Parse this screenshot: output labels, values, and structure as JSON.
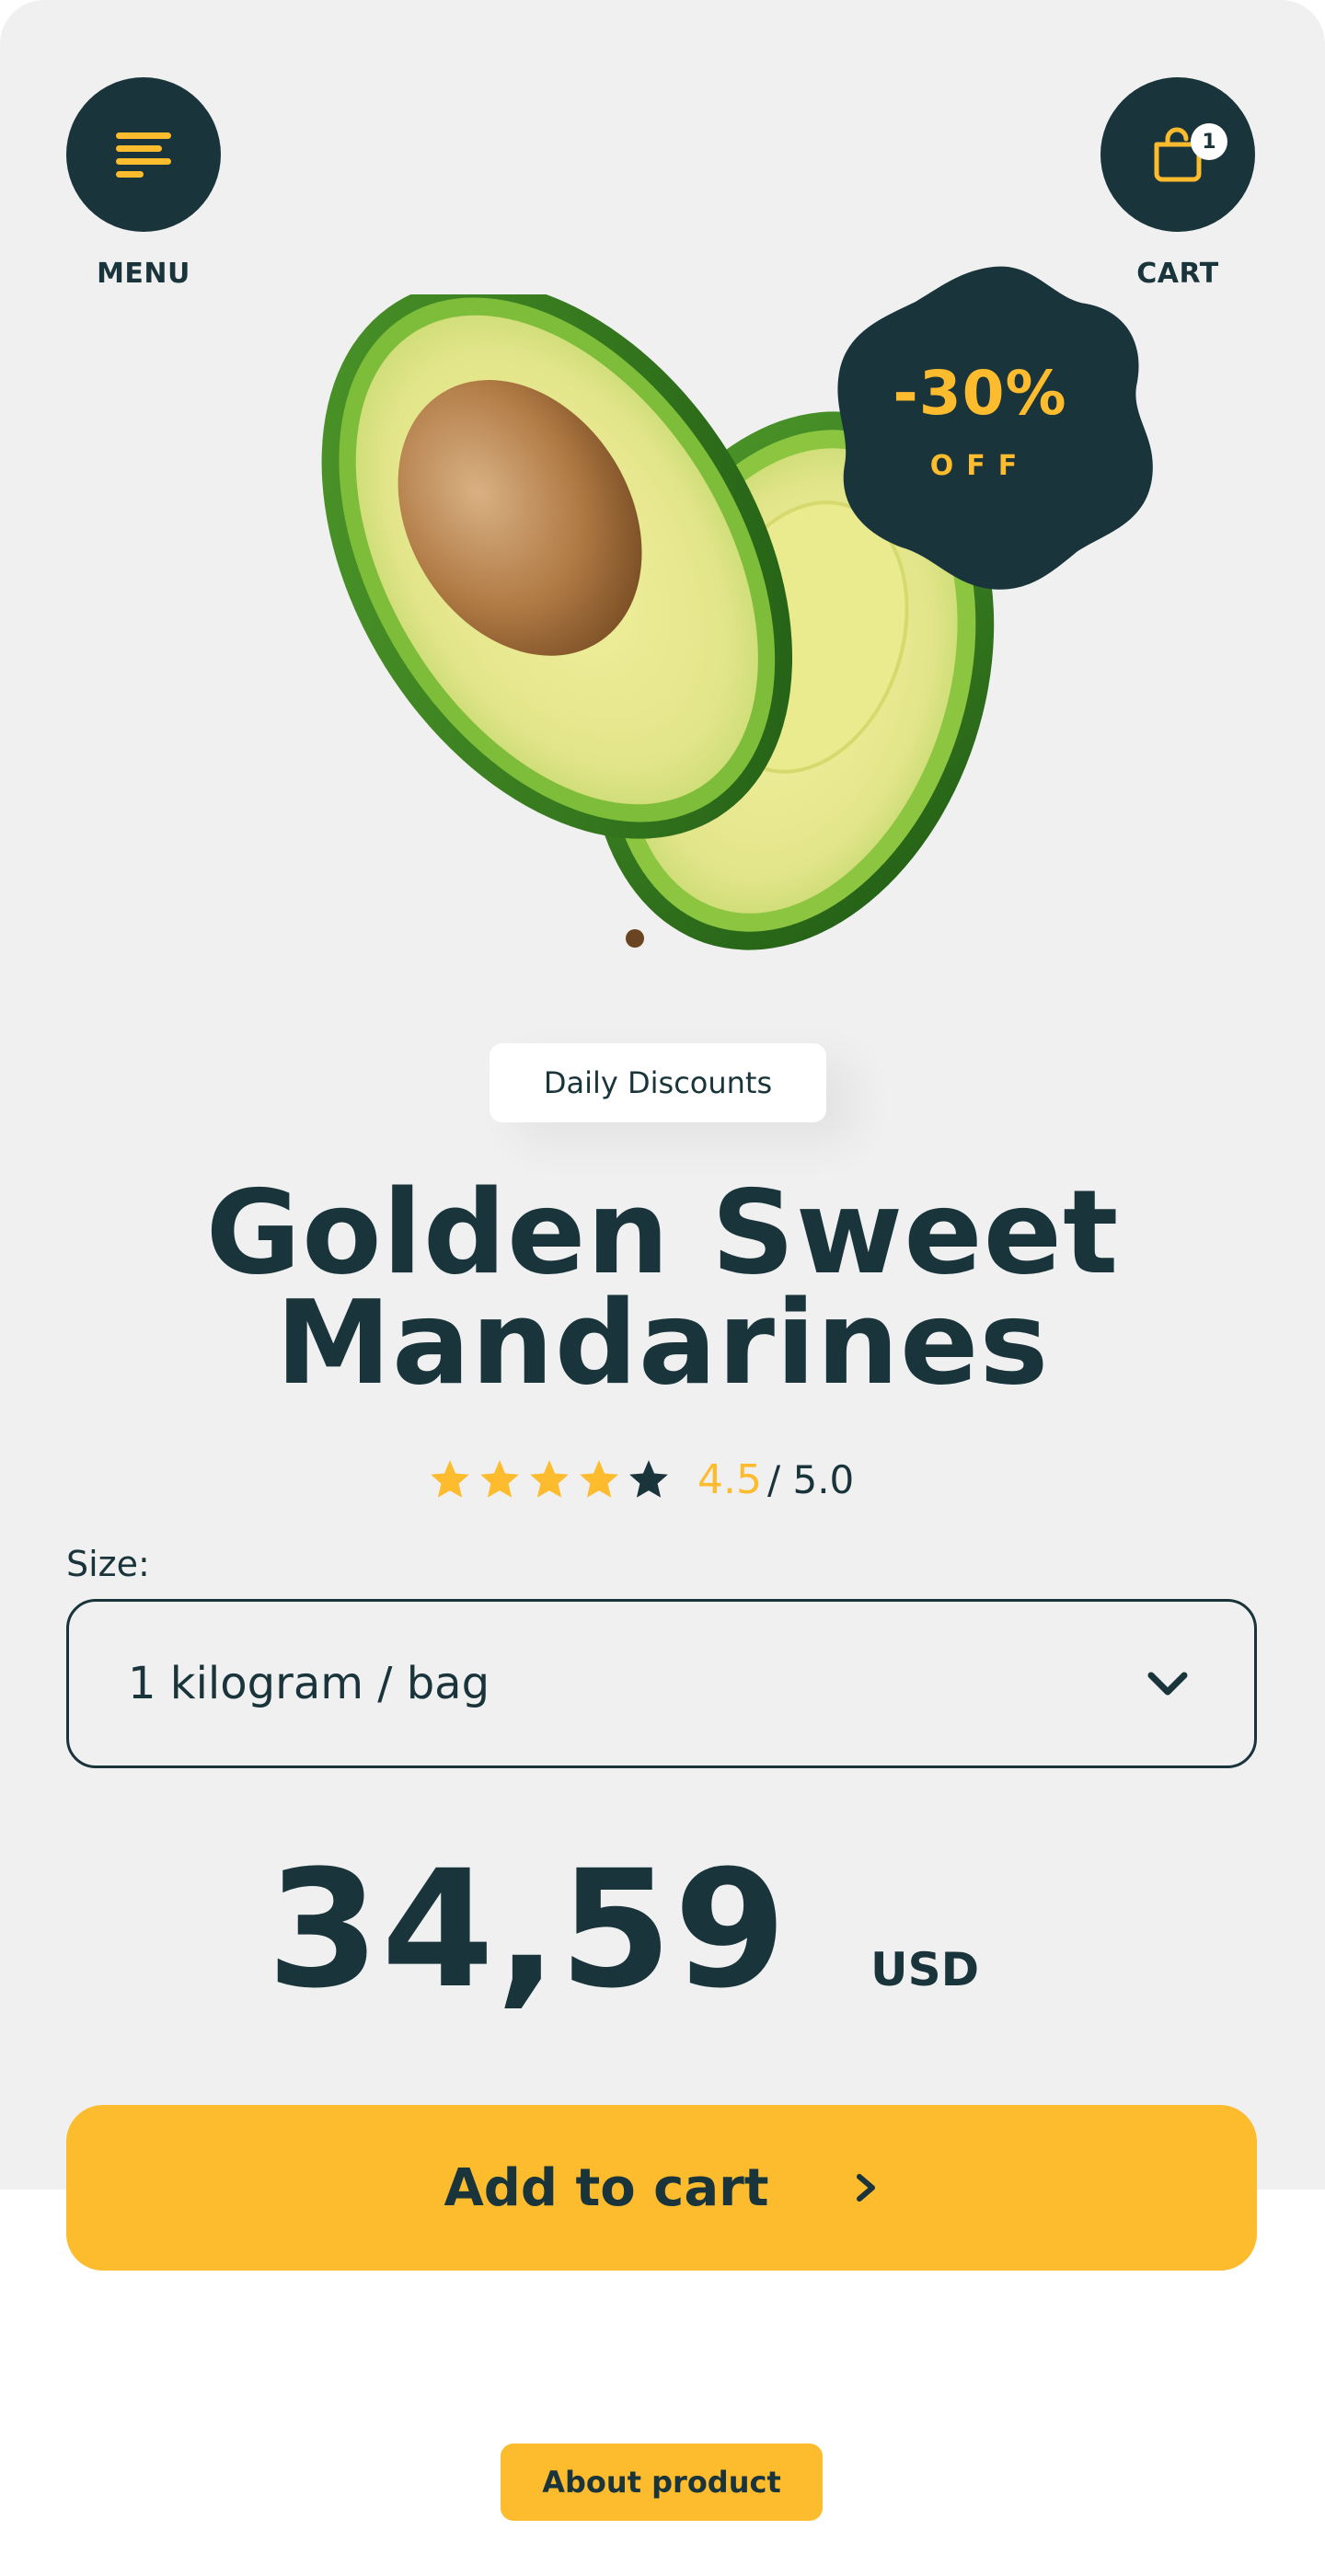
{
  "header": {
    "menu_label": "MENU",
    "cart_label": "CART",
    "cart_count": "1"
  },
  "promo": {
    "discount": "-30%",
    "off_label": "OFF"
  },
  "tag": "Daily Discounts",
  "product": {
    "title_line1": "Golden Sweet",
    "title_line2": "Mandarines",
    "rating": "4.5",
    "rating_max": "/ 5.0",
    "stars_filled": 4,
    "stars_total": 5
  },
  "size": {
    "label": "Size:",
    "selected": "1 kilogram / bag"
  },
  "price": {
    "amount": "34,59",
    "currency": "USD"
  },
  "actions": {
    "add_to_cart": "Add to cart",
    "about_product": "About product"
  },
  "colors": {
    "primary_dark": "#19343a",
    "accent_yellow": "#fdbb2e",
    "background": "#f0f0f0"
  }
}
